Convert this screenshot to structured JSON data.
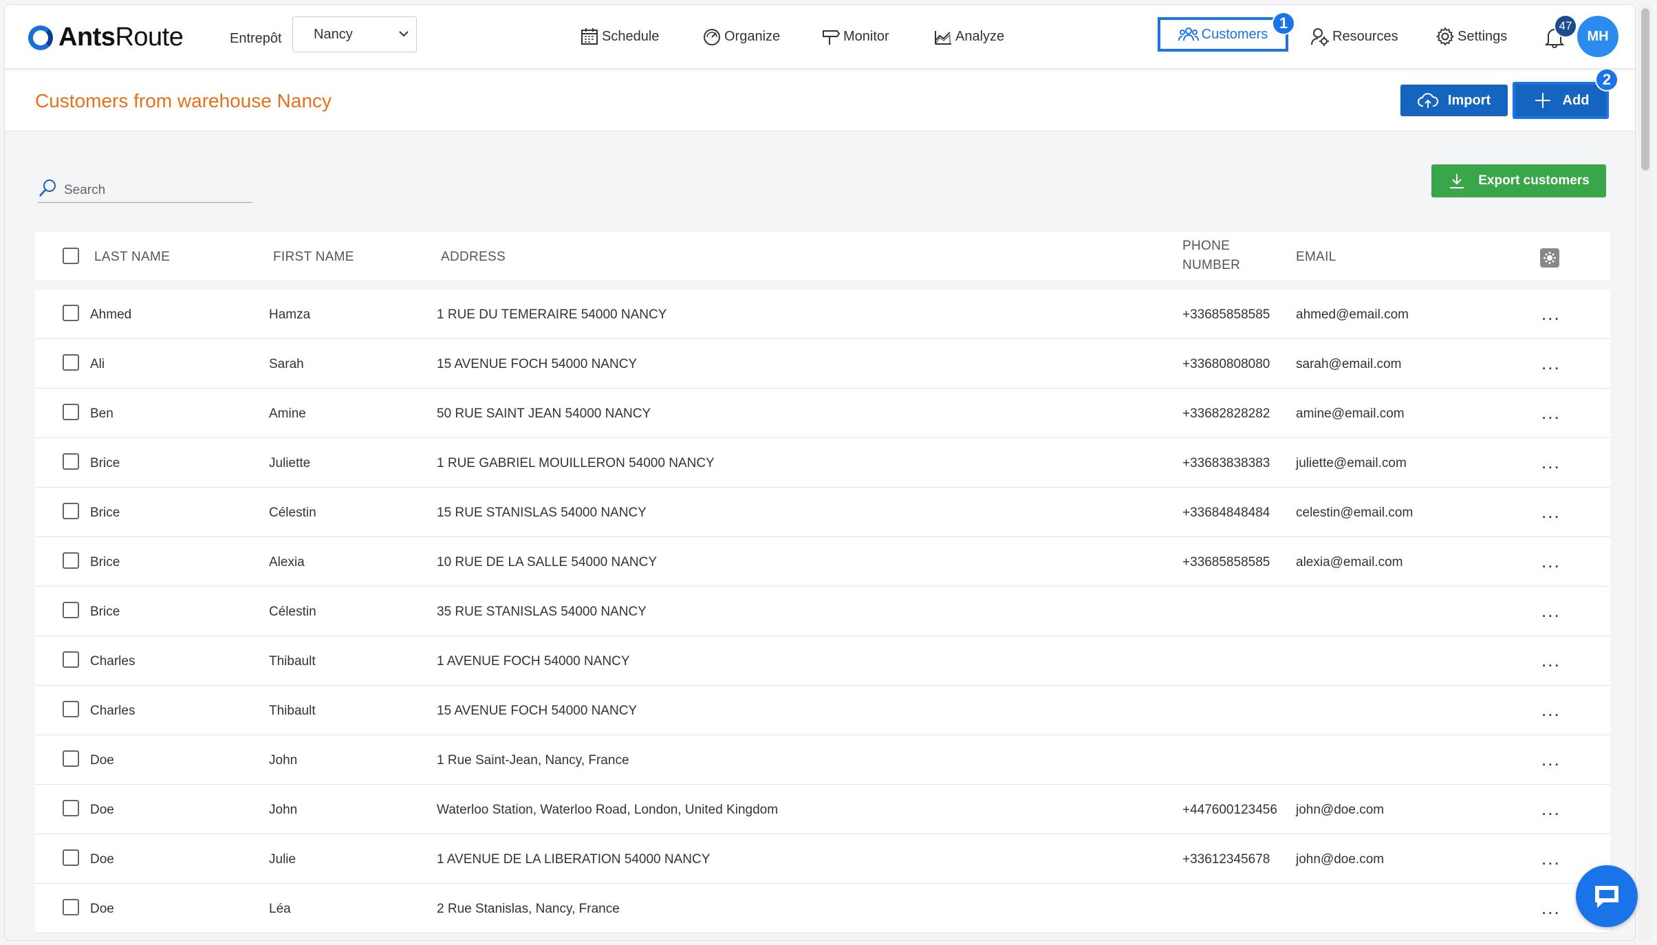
{
  "header": {
    "logo_text_bold": "Ants",
    "logo_text_light": "Route",
    "warehouse_label": "Entrepôt",
    "warehouse_value": "Nancy",
    "nav": {
      "schedule": "Schedule",
      "organize": "Organize",
      "monitor": "Monitor",
      "analyze": "Analyze",
      "customers": "Customers",
      "resources": "Resources",
      "settings": "Settings"
    },
    "step_1": "1",
    "notification_count": "47",
    "avatar_initials": "MH"
  },
  "page": {
    "title": "Customers from warehouse Nancy",
    "import_label": "Import",
    "add_label": "Add",
    "step_2": "2",
    "search_placeholder": "Search",
    "export_label": "Export customers"
  },
  "table": {
    "headers": {
      "last_name": "LAST NAME",
      "first_name": "FIRST NAME",
      "address": "ADDRESS",
      "phone_line1": "PHONE",
      "phone_line2": "NUMBER",
      "email": "EMAIL"
    },
    "rows": [
      {
        "last": "Ahmed",
        "first": "Hamza",
        "address": "1 RUE DU TEMERAIRE 54000 NANCY",
        "phone": "+33685858585",
        "email": "ahmed@email.com"
      },
      {
        "last": "Ali",
        "first": "Sarah",
        "address": "15 AVENUE FOCH 54000 NANCY",
        "phone": "+33680808080",
        "email": "sarah@email.com"
      },
      {
        "last": "Ben",
        "first": "Amine",
        "address": "50 RUE SAINT JEAN 54000 NANCY",
        "phone": "+33682828282",
        "email": "amine@email.com"
      },
      {
        "last": "Brice",
        "first": "Juliette",
        "address": "1 RUE GABRIEL MOUILLERON 54000 NANCY",
        "phone": "+33683838383",
        "email": "juliette@email.com"
      },
      {
        "last": "Brice",
        "first": "Célestin",
        "address": "15 RUE STANISLAS 54000 NANCY",
        "phone": "+33684848484",
        "email": "celestin@email.com"
      },
      {
        "last": "Brice",
        "first": "Alexia",
        "address": "10 RUE DE LA SALLE 54000 NANCY",
        "phone": "+33685858585",
        "email": "alexia@email.com"
      },
      {
        "last": "Brice",
        "first": "Célestin",
        "address": "35 RUE STANISLAS 54000 NANCY",
        "phone": "",
        "email": ""
      },
      {
        "last": "Charles",
        "first": "Thibault",
        "address": "1 AVENUE FOCH 54000 NANCY",
        "phone": "",
        "email": ""
      },
      {
        "last": "Charles",
        "first": "Thibault",
        "address": "15 AVENUE FOCH 54000 NANCY",
        "phone": "",
        "email": ""
      },
      {
        "last": "Doe",
        "first": "John",
        "address": "1 Rue Saint-Jean, Nancy, France",
        "phone": "",
        "email": ""
      },
      {
        "last": "Doe",
        "first": "John",
        "address": "Waterloo Station, Waterloo Road, London, United Kingdom",
        "phone": "+447600123456",
        "email": "john@doe.com"
      },
      {
        "last": "Doe",
        "first": "Julie",
        "address": "1 AVENUE DE LA LIBERATION 54000 NANCY",
        "phone": "+33612345678",
        "email": "john@doe.com"
      },
      {
        "last": "Doe",
        "first": "Léa",
        "address": "2 Rue Stanislas, Nancy, France",
        "phone": "",
        "email": ""
      }
    ],
    "row_menu": "..."
  },
  "icons": {
    "schedule": "calendar-icon",
    "organize": "gauge-icon",
    "monitor": "signpost-icon",
    "analyze": "chart-icon",
    "customers": "users-icon",
    "resources": "user-gear-icon",
    "settings": "gear-icon",
    "notifications": "bell-icon",
    "import": "cloud-upload-icon",
    "add": "plus-icon",
    "search": "search-icon",
    "export": "download-icon",
    "columns": "settings-square-icon",
    "chat": "chat-icon"
  },
  "colors": {
    "accent_blue": "#1a73e8",
    "button_blue": "#1565c0",
    "title_orange": "#e8701a",
    "export_green": "#3aa64a"
  }
}
